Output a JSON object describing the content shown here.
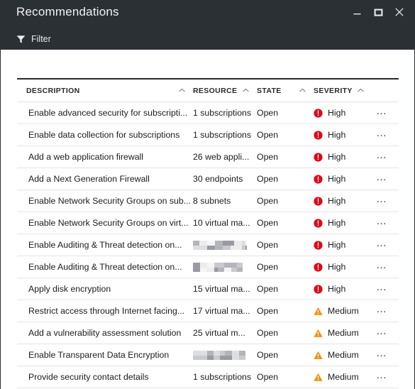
{
  "window": {
    "title": "Recommendations",
    "controls": [
      {
        "name": "minimize",
        "label": "—"
      },
      {
        "name": "maximize",
        "label": "❐"
      },
      {
        "name": "close",
        "label": "✕"
      }
    ],
    "chrome_color": "#2b3035",
    "title_color": "#f2f2f2"
  },
  "toolbar": {
    "filter_label": "Filter",
    "filter_icon": "funnel-icon"
  },
  "table": {
    "columns": [
      {
        "key": "description",
        "label": "DESCRIPTION",
        "sort_icon": "chevron-up-icon"
      },
      {
        "key": "resource",
        "label": "RESOURCE",
        "sort_icon": "chevron-up-icon"
      },
      {
        "key": "state",
        "label": "STATE",
        "sort_icon": "chevron-up-icon"
      },
      {
        "key": "severity",
        "label": "SEVERITY",
        "sort_icon": "chevron-up-icon"
      },
      {
        "key": "actions",
        "label": "",
        "sort_icon": ""
      }
    ],
    "row_action_label": "…",
    "severity_colors": {
      "High": "#dd0a17",
      "Medium": "#f4900c"
    },
    "rows": [
      {
        "description": "Enable advanced security for subscripti...",
        "resource": "1 subscriptions",
        "resource_redacted": false,
        "state": "Open",
        "severity": "High",
        "severity_icon": "error-circle-icon"
      },
      {
        "description": "Enable data collection for subscriptions",
        "resource": "1 subscriptions",
        "resource_redacted": false,
        "state": "Open",
        "severity": "High",
        "severity_icon": "error-circle-icon"
      },
      {
        "description": "Add a web application firewall",
        "resource": "26 web appli...",
        "resource_redacted": false,
        "state": "Open",
        "severity": "High",
        "severity_icon": "error-circle-icon"
      },
      {
        "description": "Add a Next Generation Firewall",
        "resource": "30 endpoints",
        "resource_redacted": false,
        "state": "Open",
        "severity": "High",
        "severity_icon": "error-circle-icon"
      },
      {
        "description": "Enable Network Security Groups on sub...",
        "resource": "8 subnets",
        "resource_redacted": false,
        "state": "Open",
        "severity": "High",
        "severity_icon": "error-circle-icon"
      },
      {
        "description": "Enable Network Security Groups on virt...",
        "resource": "10 virtual ma...",
        "resource_redacted": false,
        "state": "Open",
        "severity": "High",
        "severity_icon": "error-circle-icon"
      },
      {
        "description": "Enable Auditing & Threat detection on...",
        "resource": "",
        "resource_redacted": true,
        "state": "Open",
        "severity": "High",
        "severity_icon": "error-circle-icon"
      },
      {
        "description": "Enable Auditing & Threat detection on...",
        "resource": "",
        "resource_redacted": true,
        "state": "Open",
        "severity": "High",
        "severity_icon": "error-circle-icon"
      },
      {
        "description": "Apply disk encryption",
        "resource": "15 virtual ma...",
        "resource_redacted": false,
        "state": "Open",
        "severity": "High",
        "severity_icon": "error-circle-icon"
      },
      {
        "description": "Restrict access through Internet facing...",
        "resource": "17 virtual ma...",
        "resource_redacted": false,
        "state": "Open",
        "severity": "Medium",
        "severity_icon": "warning-triangle-icon"
      },
      {
        "description": "Add a vulnerability assessment solution",
        "resource": "25 virtual m...",
        "resource_redacted": false,
        "state": "Open",
        "severity": "Medium",
        "severity_icon": "warning-triangle-icon"
      },
      {
        "description": "Enable Transparent Data Encryption",
        "resource": "",
        "resource_redacted": true,
        "state": "Open",
        "severity": "Medium",
        "severity_icon": "warning-triangle-icon"
      },
      {
        "description": "Provide security contact details",
        "resource": "1 subscriptions",
        "resource_redacted": false,
        "state": "Open",
        "severity": "Medium",
        "severity_icon": "warning-triangle-icon"
      }
    ]
  }
}
